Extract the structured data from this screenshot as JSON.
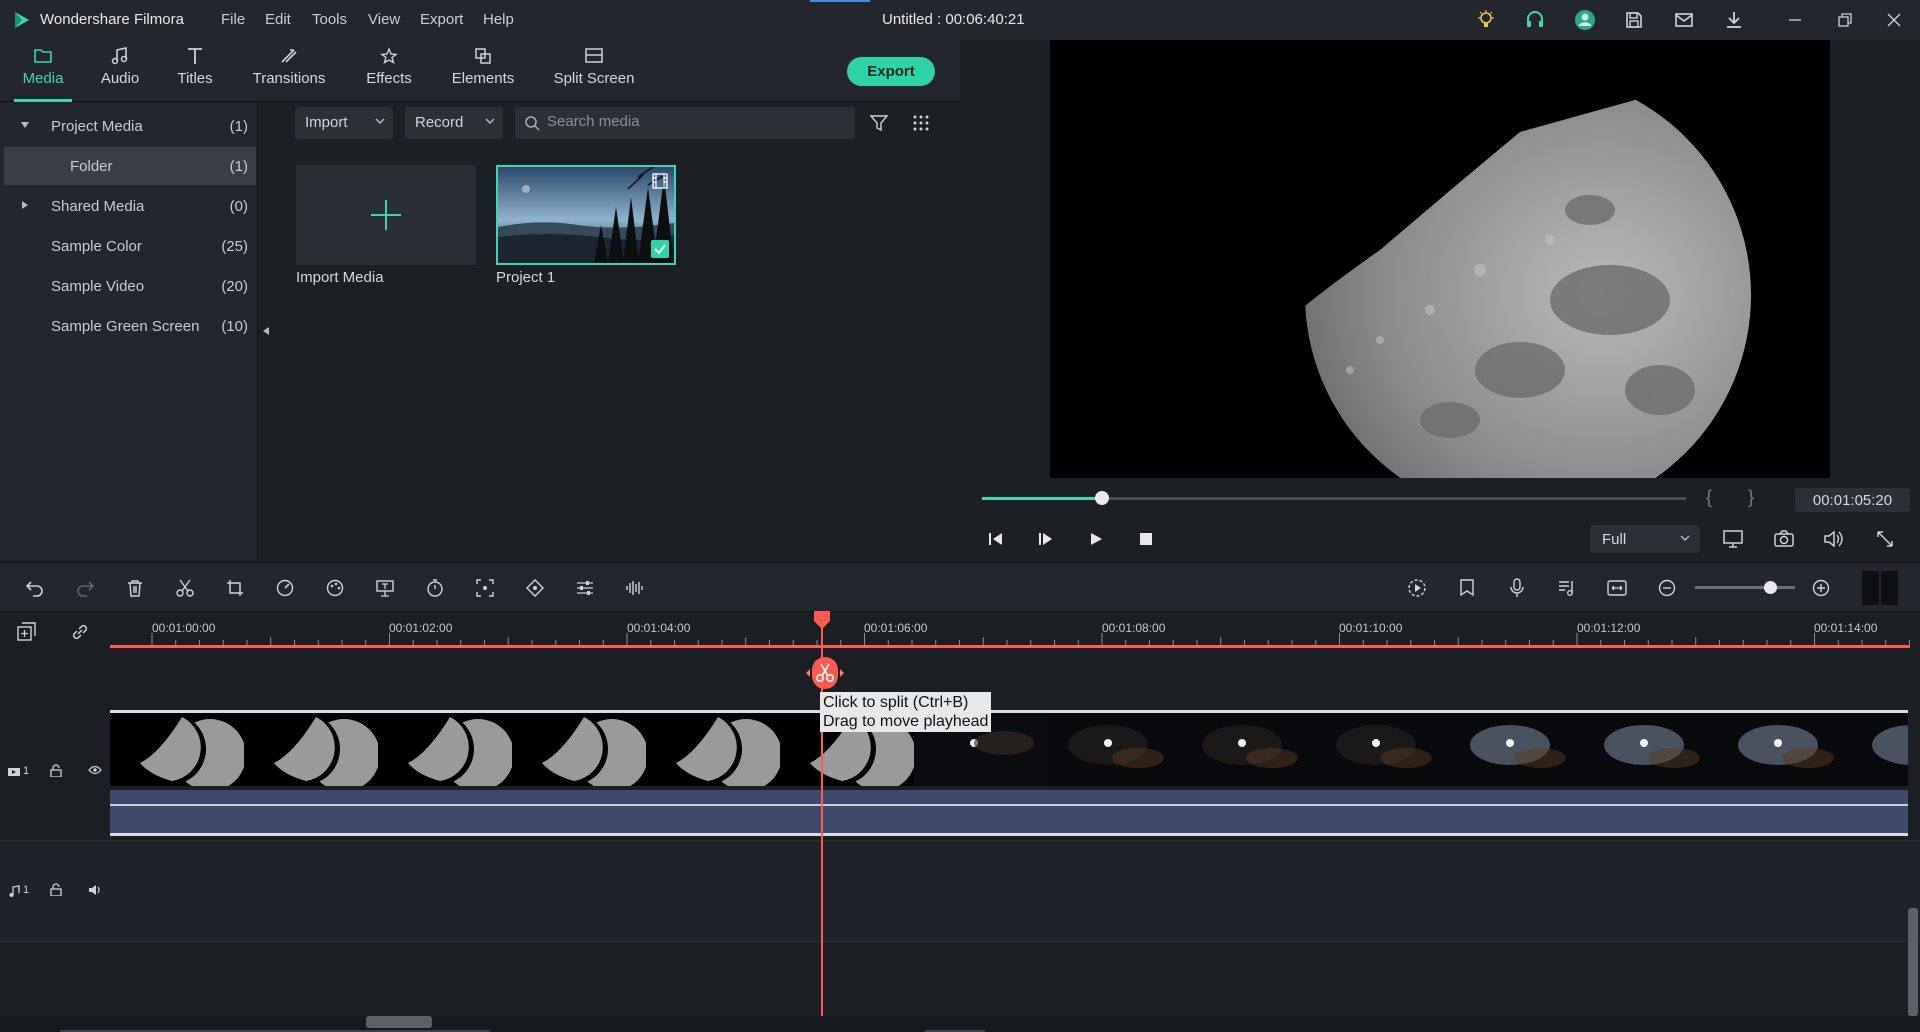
{
  "app": {
    "name": "Wondershare Filmora",
    "document_title": "Untitled : 00:06:40:21",
    "menu": [
      "File",
      "Edit",
      "Tools",
      "View",
      "Export",
      "Help"
    ]
  },
  "modules": {
    "tabs": [
      {
        "label": "Media",
        "icon": "folder-icon",
        "active": true
      },
      {
        "label": "Audio",
        "icon": "music-note-icon"
      },
      {
        "label": "Titles",
        "icon": "text-icon"
      },
      {
        "label": "Transitions",
        "icon": "transition-icon"
      },
      {
        "label": "Effects",
        "icon": "effects-icon"
      },
      {
        "label": "Elements",
        "icon": "elements-icon"
      },
      {
        "label": "Split Screen",
        "icon": "split-screen-icon"
      }
    ],
    "export_label": "Export"
  },
  "sidebar": {
    "items": [
      {
        "name": "Project Media",
        "count": "(1)",
        "expanded": true
      },
      {
        "name": "Folder",
        "count": "(1)",
        "selected": true
      },
      {
        "name": "Shared Media",
        "count": "(0)",
        "expanded": false
      },
      {
        "name": "Sample Color",
        "count": "(25)"
      },
      {
        "name": "Sample Video",
        "count": "(20)"
      },
      {
        "name": "Sample Green Screen",
        "count": "(10)"
      }
    ]
  },
  "media_bar": {
    "import_label": "Import",
    "record_label": "Record",
    "search_placeholder": "Search media"
  },
  "media": {
    "items": [
      {
        "label": "Import Media",
        "type": "import"
      },
      {
        "label": "Project 1",
        "type": "project",
        "selected": true
      }
    ]
  },
  "preview": {
    "timecode": "00:01:05:20",
    "progress": 0.17,
    "quality": "Full",
    "brace_open": "{",
    "brace_close": "}"
  },
  "timeline": {
    "ruler_labels": [
      "00:01:00:00",
      "00:01:02:00",
      "00:01:04:00",
      "00:01:06:00",
      "00:01:08:00",
      "00:01:10:00",
      "00:01:12:00",
      "00:01:14:00"
    ],
    "tooltip_line1": "Click to split (Ctrl+B)",
    "tooltip_line2": "Drag to move playhead",
    "video_track_label": "1",
    "audio_track_label": "1",
    "zoom_level": 0.75
  },
  "colors": {
    "accent": "#3ad6b5",
    "playhead": "#ff5a52",
    "audio_track": "#3d4a6b"
  }
}
